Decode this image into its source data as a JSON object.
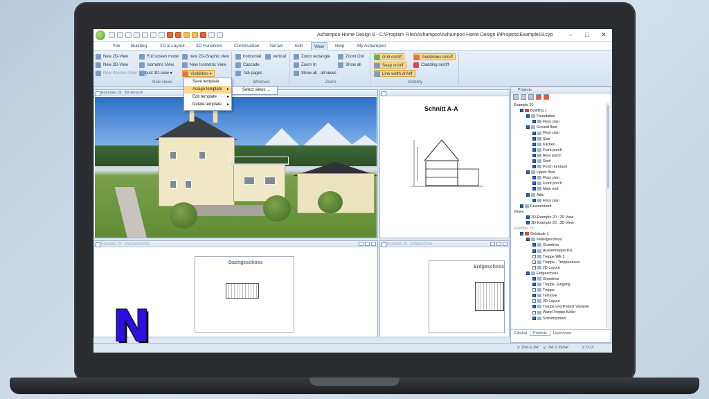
{
  "window": {
    "title": "Ashampoo Home Design 8 - C:\\Program Files\\Ashampoo\\Ashampoo Home Design 8\\Projects\\Example19.cyp",
    "minimize": "–",
    "maximize": "□",
    "close": "✕"
  },
  "menu": [
    "File",
    "Building",
    "2D & Layout",
    "3D Functions",
    "Construction",
    "Terrain",
    "Edit",
    "View",
    "Help",
    "My Ashampoo"
  ],
  "active_menu": "View",
  "ribbon": {
    "new_views": {
      "label": "New views",
      "items": [
        "New 2D-View",
        "New 3D-View",
        "New Section-View",
        "Full screen mode",
        "Isometric View",
        "Adjust 3D-view ▾",
        "new 2D-Graphic view",
        "New Isometric View",
        "Visibilities ▾"
      ]
    },
    "windows": {
      "label": "Windows",
      "items": [
        "horizontal",
        "vertical",
        "Cascade",
        "Tab pages"
      ]
    },
    "zoom": {
      "label": "Zoom",
      "items": [
        "Zoom rectangle",
        "Zoom Out",
        "Zoom In",
        "Show all",
        "Show all - all views"
      ]
    },
    "visibility": {
      "label": "Visibility",
      "items": [
        "Grid on/off",
        "Guidelines on/off",
        "Snap on/off",
        "Cladding on/off",
        "Line width on/off"
      ]
    }
  },
  "dropdown": {
    "items": [
      "Save template",
      "Assign template",
      "Edit template",
      "Delete template"
    ],
    "submenu": "Select views ..."
  },
  "panes": {
    "view3d_title": "Example 19 : 3D-Ansicht",
    "section_title": "Schnitt A-A",
    "plan1_title": "Example 19 : Dachgeschoss",
    "plan1_label": "Dachgeschoss",
    "plan2_title": "Example 19 : Erdgeschoss",
    "plan2_label": "Erdgeschoss"
  },
  "projects": {
    "title": "Projects",
    "tree": [
      {
        "t": "Example 20",
        "lvl": 0,
        "cb": false,
        "ic": ""
      },
      {
        "t": "Building 1",
        "lvl": 1,
        "cb": true,
        "ic": "house"
      },
      {
        "t": "Foundation",
        "lvl": 2,
        "cb": true,
        "ic": "s"
      },
      {
        "t": "Floor plan",
        "lvl": 3,
        "cb": true,
        "ic": "s"
      },
      {
        "t": "Ground floor",
        "lvl": 2,
        "cb": true,
        "ic": "s"
      },
      {
        "t": "Floor plan",
        "lvl": 3,
        "cb": true,
        "ic": "s"
      },
      {
        "t": "Stair",
        "lvl": 3,
        "cb": true,
        "ic": "s"
      },
      {
        "t": "Kitchen",
        "lvl": 3,
        "cb": true,
        "ic": "s"
      },
      {
        "t": "Front porch",
        "lvl": 3,
        "cb": true,
        "ic": "s"
      },
      {
        "t": "Rear porch",
        "lvl": 3,
        "cb": true,
        "ic": "s"
      },
      {
        "t": "Roof",
        "lvl": 3,
        "cb": true,
        "ic": "s"
      },
      {
        "t": "Porch furniture",
        "lvl": 3,
        "cb": true,
        "ic": "s"
      },
      {
        "t": "Upper floor",
        "lvl": 2,
        "cb": true,
        "ic": "s"
      },
      {
        "t": "Floor plan",
        "lvl": 3,
        "cb": true,
        "ic": "s"
      },
      {
        "t": "Front porch",
        "lvl": 3,
        "cb": true,
        "ic": "s"
      },
      {
        "t": "Main roof",
        "lvl": 3,
        "cb": true,
        "ic": "s"
      },
      {
        "t": "Attic",
        "lvl": 2,
        "cb": true,
        "ic": "s"
      },
      {
        "t": "Floor plan",
        "lvl": 3,
        "cb": true,
        "ic": "s"
      },
      {
        "t": "Environment",
        "lvl": 1,
        "cb": true,
        "ic": "s"
      },
      {
        "t": "Views",
        "lvl": 0,
        "cb": false,
        "ic": ""
      },
      {
        "t": "2D Example 20 : 2D View",
        "lvl": 2,
        "cb": true,
        "ic": ""
      },
      {
        "t": "3D Example 20 : 3D-View",
        "lvl": 2,
        "cb": true,
        "ic": ""
      },
      {
        "t": "Example 19",
        "lvl": 0,
        "cb": false,
        "ic": "",
        "gray": true
      },
      {
        "t": "Gebäude 1",
        "lvl": 1,
        "cb": true,
        "ic": "house"
      },
      {
        "t": "Kellergeschoss",
        "lvl": 2,
        "cb": true,
        "ic": "s"
      },
      {
        "t": "Grundriss",
        "lvl": 3,
        "cb": true,
        "ic": "s"
      },
      {
        "t": "Aussentreppe KG",
        "lvl": 3,
        "cb": true,
        "ic": "s"
      },
      {
        "t": "Treppe WE 1",
        "lvl": 3,
        "cb": false,
        "ic": "s"
      },
      {
        "t": "Treppe - Treppenhaus",
        "lvl": 3,
        "cb": false,
        "ic": "s"
      },
      {
        "t": "2D Layout",
        "lvl": 3,
        "cb": false,
        "ic": "s"
      },
      {
        "t": "Erdgeschoss",
        "lvl": 2,
        "cb": true,
        "ic": "s"
      },
      {
        "t": "Grundriss",
        "lvl": 3,
        "cb": true,
        "ic": "s"
      },
      {
        "t": "Treppe, Eingang",
        "lvl": 3,
        "cb": true,
        "ic": "s"
      },
      {
        "t": "Treppe",
        "lvl": 3,
        "cb": false,
        "ic": "s"
      },
      {
        "t": "Terrasse",
        "lvl": 3,
        "cb": true,
        "ic": "s"
      },
      {
        "t": "2D Layout",
        "lvl": 3,
        "cb": false,
        "ic": "s"
      },
      {
        "t": "Treppe und Podest Variante",
        "lvl": 3,
        "cb": true,
        "ic": "s"
      },
      {
        "t": "Wand Treppe Keller",
        "lvl": 3,
        "cb": false,
        "ic": "s"
      },
      {
        "t": "Schnittsymbol",
        "lvl": 3,
        "cb": true,
        "ic": "s"
      }
    ],
    "tabs": [
      "Catalog",
      "Projects",
      "Layer/view"
    ]
  },
  "status": {
    "x": "x: 154'-6 3/4\"",
    "y": "y: -54'-3 39/64\"",
    "z": "z: 0'-0\""
  },
  "logo_letter": "N"
}
